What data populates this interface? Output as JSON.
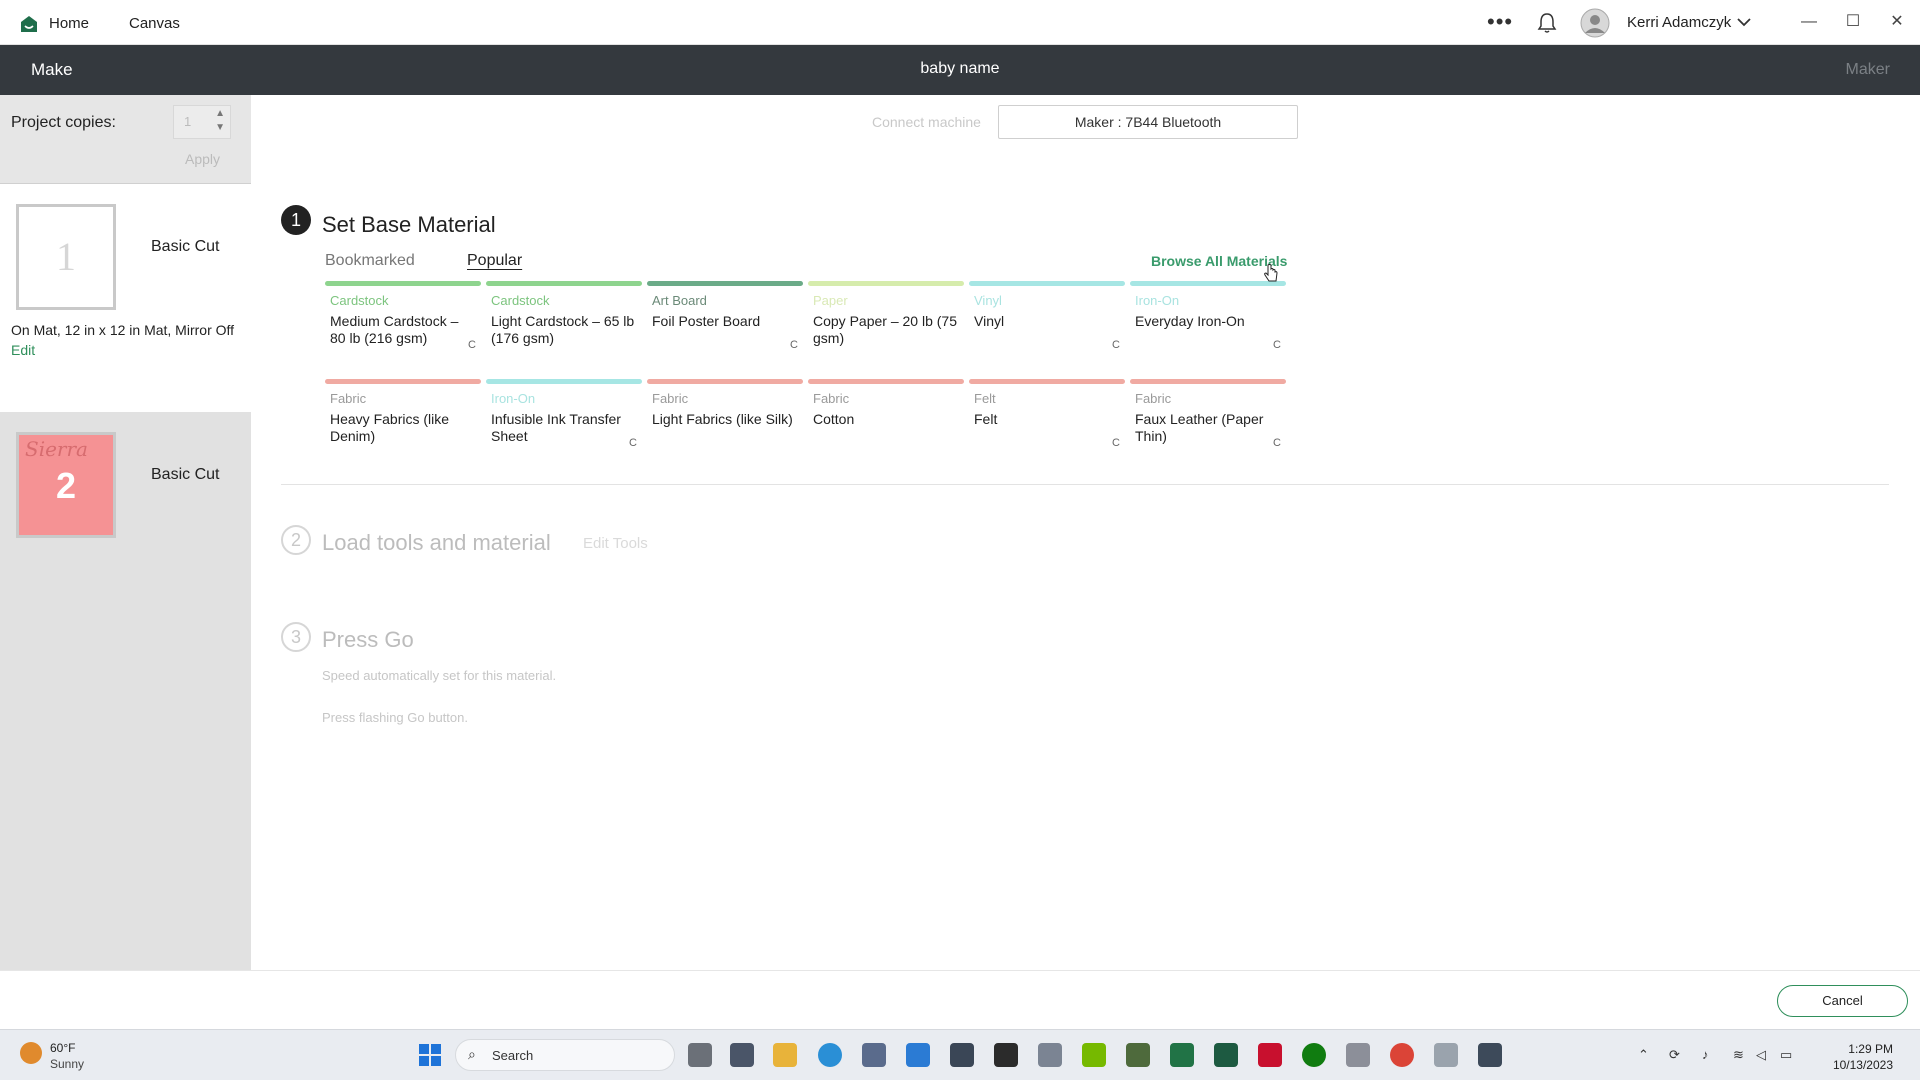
{
  "titlebar": {
    "home_label": "Home",
    "canvas_label": "Canvas",
    "more": "•••",
    "user_name": "Kerri Adamczyk"
  },
  "makebar": {
    "title": "Make",
    "project_name": "baby name",
    "machine_right": "Maker"
  },
  "sidebar": {
    "copies_label": "Project copies:",
    "copies_value": "1",
    "apply_label": "Apply",
    "mats": [
      {
        "number": "1",
        "label": "Basic Cut",
        "info": "On Mat, 12 in x 12 in Mat, Mirror Off",
        "edit": "Edit"
      },
      {
        "number": "2",
        "label": "Basic Cut",
        "script_text": "Sierra"
      }
    ]
  },
  "connect": {
    "label": "Connect machine",
    "machine": "Maker : 7B44 Bluetooth"
  },
  "steps": [
    {
      "number": "1",
      "title": "Set Base Material"
    },
    {
      "number": "2",
      "title": "Load tools and material",
      "action": "Edit Tools"
    },
    {
      "number": "3",
      "title": "Press Go",
      "hints": [
        "Speed automatically set for this material.",
        "Press flashing Go button."
      ]
    }
  ],
  "tabs": {
    "bookmarked": "Bookmarked",
    "popular": "Popular",
    "browse_all": "Browse All Materials"
  },
  "materials": [
    {
      "category": "Cardstock",
      "name": "Medium Cardstock – 80 lb (216 gsm)",
      "color": "#8ed48e",
      "cat_color": "#7cc47e",
      "c": "C"
    },
    {
      "category": "Cardstock",
      "name": "Light Cardstock – 65 lb (176 gsm)",
      "color": "#8ed48e",
      "cat_color": "#7cc47e",
      "c": ""
    },
    {
      "category": "Art Board",
      "name": "Foil Poster Board",
      "color": "#6bab88",
      "cat_color": "#6b8a78",
      "c": "C"
    },
    {
      "category": "Paper",
      "name": "Copy Paper – 20 lb (75 gsm)",
      "color": "#d6ecac",
      "cat_color": "#d9e9b5",
      "c": ""
    },
    {
      "category": "Vinyl",
      "name": "Vinyl",
      "color": "#a6e6e4",
      "cat_color": "#a9e3e0",
      "c": "C"
    },
    {
      "category": "Iron-On",
      "name": "Everyday Iron-On",
      "color": "#a6e6e4",
      "cat_color": "#a9e3e0",
      "c": "C"
    },
    {
      "category": "Fabric",
      "name": "Heavy Fabrics (like Denim)",
      "color": "#f0aaa2",
      "cat_color": "#9a9a9a",
      "c": ""
    },
    {
      "category": "Iron-On",
      "name": "Infusible Ink Transfer Sheet",
      "color": "#a6e6e4",
      "cat_color": "#a9e3e0",
      "c": "C"
    },
    {
      "category": "Fabric",
      "name": "Light Fabrics (like Silk)",
      "color": "#f0aaa2",
      "cat_color": "#9a9a9a",
      "c": ""
    },
    {
      "category": "Fabric",
      "name": "Cotton",
      "color": "#f0aaa2",
      "cat_color": "#9a9a9a",
      "c": ""
    },
    {
      "category": "Felt",
      "name": "Felt",
      "color": "#f0aaa2",
      "cat_color": "#9a9a9a",
      "c": "C"
    },
    {
      "category": "Fabric",
      "name": "Faux Leather (Paper Thin)",
      "color": "#f0aaa2",
      "cat_color": "#9a9a9a",
      "c": "C"
    }
  ],
  "footer": {
    "cancel_label": "Cancel"
  },
  "taskbar": {
    "temp": "60°F",
    "condition": "Sunny",
    "search_label": "Search",
    "time": "1:29 PM",
    "date": "10/13/2023"
  },
  "colors": {
    "accent": "#2f8f5b",
    "header_bg": "#34393e",
    "sidebar_bg": "#e1e1e1"
  }
}
